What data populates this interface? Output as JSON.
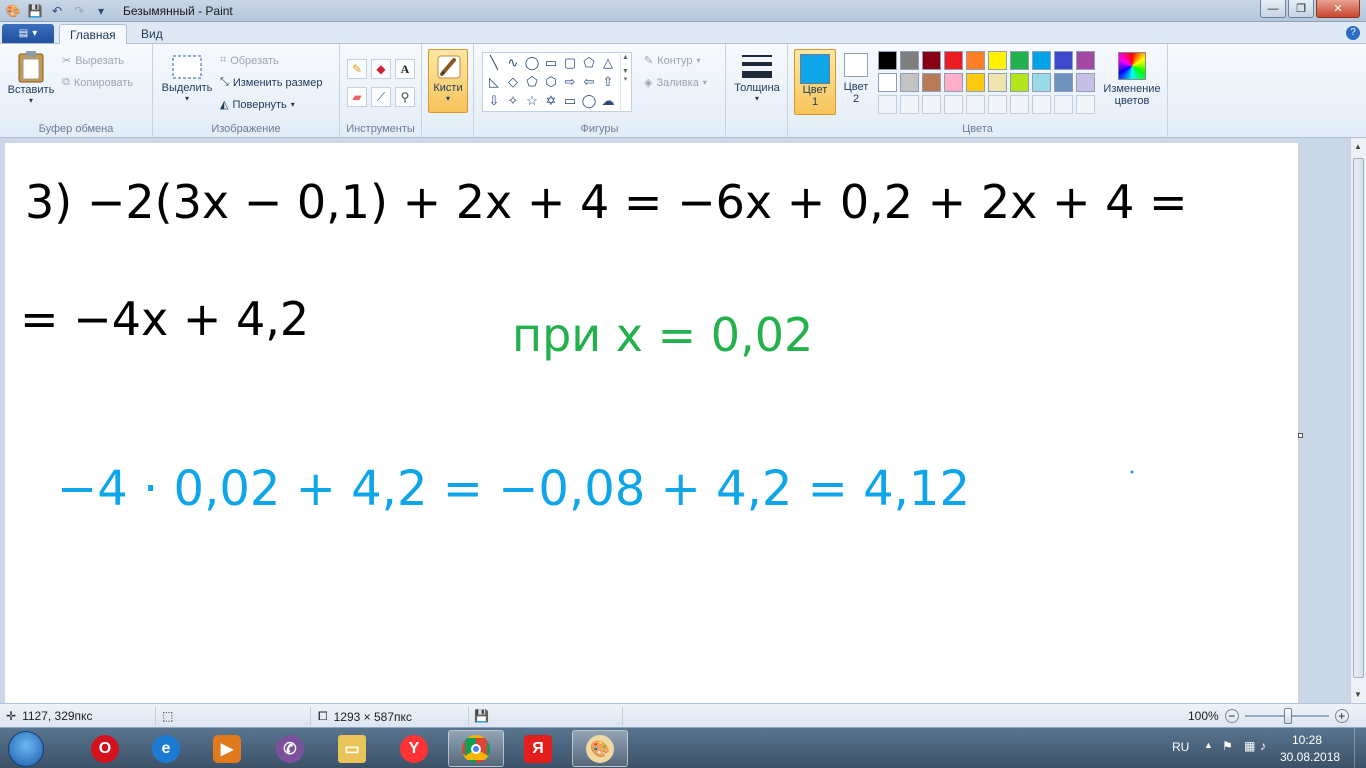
{
  "window": {
    "title": "Безымянный - Paint"
  },
  "tabs": [
    {
      "label": "Главная"
    },
    {
      "label": "Вид"
    }
  ],
  "ribbon": {
    "clipboard": {
      "label": "Буфер обмена",
      "paste": "Вставить",
      "cut": "Вырезать",
      "copy": "Копировать"
    },
    "image": {
      "label": "Изображение",
      "select": "Выделить",
      "crop": "Обрезать",
      "resize": "Изменить размер",
      "rotate": "Повернуть"
    },
    "tools": {
      "label": "Инструменты"
    },
    "brushes": {
      "label": "Кисти"
    },
    "shapes": {
      "label": "Фигуры",
      "outline": "Контур",
      "fill": "Заливка"
    },
    "size": {
      "label": "Толщина"
    },
    "colors": {
      "label": "Цвета",
      "color1_line1": "Цвет",
      "color1_line2": "1",
      "color2_line1": "Цвет",
      "color2_line2": "2",
      "edit_line1": "Изменение",
      "edit_line2": "цветов",
      "color1_value": "#0ea5e9",
      "color2_value": "#ffffff",
      "row1": [
        "#000000",
        "#7f7f7f",
        "#880015",
        "#ed1c24",
        "#ff7f27",
        "#fff200",
        "#22b14c",
        "#00a2e8",
        "#3f48cc",
        "#a349a4"
      ],
      "row2": [
        "#ffffff",
        "#c3c3c3",
        "#b97a57",
        "#ffaec9",
        "#ffc90e",
        "#efe4b0",
        "#b5e61d",
        "#99d9ea",
        "#7092be",
        "#c8bfe7"
      ]
    }
  },
  "canvas_content": {
    "line1": "3) −2(3x − 0,1) + 2x + 4 = −6x + 0,2 + 2x + 4 =",
    "line2": "= −4x + 4,2",
    "condition": "при x = 0,02",
    "result": "−4 · 0,02 + 4,2 = −0,08 + 4,2 = 4,12",
    "colors": {
      "black_ink": "#000000",
      "green_ink": "#22b14c",
      "blue_ink": "#0ea5e9"
    }
  },
  "statusbar": {
    "cursor_pos": "1127, 329пкс",
    "image_size": "1293 × 587пкс",
    "zoom": "100%"
  },
  "taskbar": {
    "apps": [
      "opera-icon",
      "ie-icon",
      "media-player-icon",
      "viber-icon",
      "explorer-icon",
      "yandex-icon",
      "chrome-icon",
      "yandex-browser-icon",
      "paint-icon"
    ],
    "lang": "RU",
    "time": "10:28",
    "date": "30.08.2018"
  }
}
